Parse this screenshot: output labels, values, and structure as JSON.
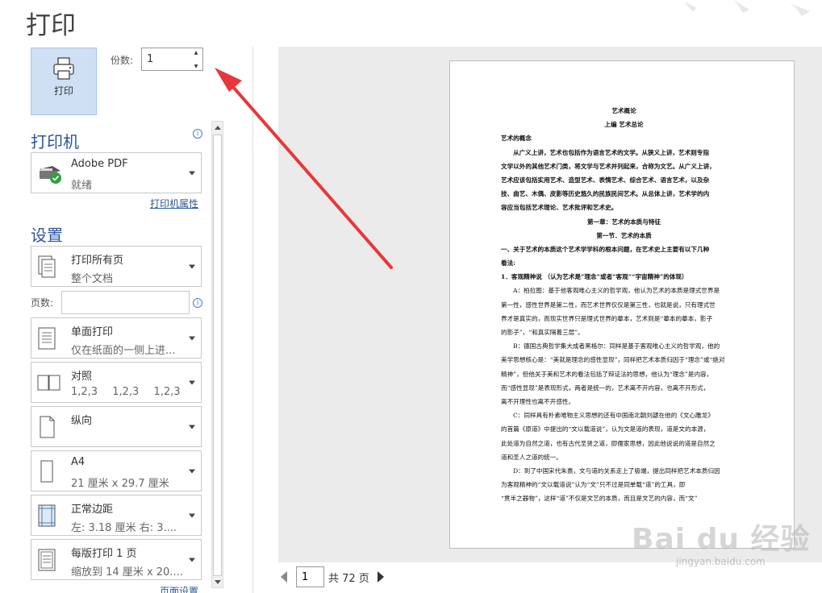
{
  "title": "打印",
  "print_button": {
    "label": "打印"
  },
  "copies": {
    "label": "份数:",
    "value": "1"
  },
  "printer": {
    "heading": "打印机",
    "name": "Adobe PDF",
    "status": "就绪",
    "properties_link": "打印机属性"
  },
  "settings": {
    "heading": "设置",
    "pages_label": "页数:",
    "pages_value": "",
    "items": [
      {
        "id": "range",
        "line1": "打印所有页",
        "line2": "整个文档"
      },
      {
        "id": "sides",
        "line1": "单面打印",
        "line2": "仅在纸面的一侧上进..."
      },
      {
        "id": "collate",
        "line1": "对照",
        "line2_parts": [
          "1,2,3",
          "1,2,3",
          "1,2,3"
        ]
      },
      {
        "id": "orientation",
        "line1": "纵向",
        "line2": ""
      },
      {
        "id": "paper",
        "line1": "A4",
        "line2": "21 厘米 x 29.7 厘米"
      },
      {
        "id": "margins",
        "line1": "正常边距",
        "line2": "左: 3.18 厘米    右: 3...."
      },
      {
        "id": "scale",
        "line1": "每版打印 1 页",
        "line2": "缩放到 14 厘米 x 20...."
      }
    ],
    "page_setup_link": "页面设置"
  },
  "pager": {
    "current": "1",
    "total_text": "共 72 页"
  },
  "document": {
    "lines": [
      {
        "text": "艺术概论",
        "style": "c"
      },
      {
        "text": "上编 艺术总论",
        "style": "c"
      },
      {
        "text": "艺术的概念",
        "style": "b"
      },
      {
        "text": "从广义上讲，艺术也包括作为语言艺术的文学。从狭义上讲，艺术则专指",
        "style": "b ind"
      },
      {
        "text": "文学以外的其他艺术门类，将文学与艺术并列起来，合称为文艺。从广义上讲，",
        "style": "b"
      },
      {
        "text": "艺术应该包括实用艺术、造型艺术、表情艺术、综合艺术、语言艺术，以及杂",
        "style": "b"
      },
      {
        "text": "技、曲艺、木偶、皮影等历史悠久的民族民间艺术。从总体上讲，艺术学的内",
        "style": "b"
      },
      {
        "text": "容应当包括艺术理论、艺术批评和艺术史。",
        "style": "b"
      },
      {
        "text": "第一章：艺术的本质与特征",
        "style": "c"
      },
      {
        "text": "第一节．艺术的本质",
        "style": "c"
      },
      {
        "text": "一、关于艺术的本质这个艺术学学科的根本问题，在艺术史上主要有以下几种",
        "style": "b"
      },
      {
        "text": "看法:",
        "style": "b"
      },
      {
        "text": "1．客观精神说 （认为艺术是“理念”或者“客观”“宇宙精神”的体现）",
        "style": "b"
      },
      {
        "text": "A：柏拉图：基于他客观唯心主义的哲学观，他认为艺术的本质是理式世界是",
        "style": "ind"
      },
      {
        "text": "第一性，感性世界是第二性，而艺术世界仅仅是第三性，也就是说，只有理式世",
        "style": ""
      },
      {
        "text": "界才是真实的，而现实世界只是理式世界的摹本，艺术则是“摹本的摹本，影子",
        "style": ""
      },
      {
        "text": "的影子”，“和真实隔着三层”。",
        "style": ""
      },
      {
        "text": "B：德国古典哲学集大成者黑格尔：同样是基于客观唯心主义的哲学观，他的",
        "style": "ind"
      },
      {
        "text": "美学思想核心是：“美就是理念的感性显现”，同样把艺术本质归因于“理念”或“绝对",
        "style": ""
      },
      {
        "text": "精神”，但他关于美和艺术的看法包括了辩证法的思想，他认为“理念”是内容，",
        "style": ""
      },
      {
        "text": "而“感性显现”是表现形式，两者是统一的，艺术离不开内容，也离不开形式，",
        "style": ""
      },
      {
        "text": "离不开理性也离不开感性。",
        "style": ""
      },
      {
        "text": "C：同样具有朴素唯物主义思想的还有中国南北朝刘勰在他的《文心雕龙》",
        "style": "ind"
      },
      {
        "text": "的首篇《原道》中提出的“文以载道说”，认为文是道的表现，道是文的本源，",
        "style": ""
      },
      {
        "text": "此处道为自然之道，也有古代圣贤之道，即儒家思想，因此他说说的道是自然之",
        "style": ""
      },
      {
        "text": "道和圣人之道的统一。",
        "style": ""
      },
      {
        "text": "D：到了中国宋代朱熹，文与道的关系走上了极端，提出同样把艺术本质归因",
        "style": "ind"
      },
      {
        "text": "为客观精神的“文以载道说”认为“文”只不过是同单载“道”的工具，即",
        "style": ""
      },
      {
        "text": "“贯半之器物”，这样“道”不仅是文艺的本质，而且是文艺的内容，而“文”",
        "style": ""
      }
    ]
  },
  "watermark": {
    "logo": "Bai du 经验",
    "url": "jingyan.baidu.com"
  },
  "colors": {
    "accent": "#2b579a",
    "button_bg": "#cfe0f5",
    "arrow": "#e8373a"
  }
}
